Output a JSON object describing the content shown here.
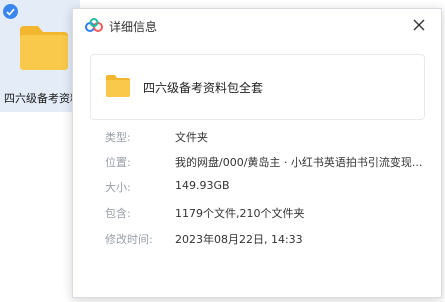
{
  "background": {
    "file_name": "四六级备考资料包全套"
  },
  "dialog": {
    "title": "详细信息",
    "item_name": "四六级备考资料包全套",
    "fields": [
      {
        "label": "类型:",
        "value": "文件夹"
      },
      {
        "label": "位置:",
        "value": "我的网盘/000/黄岛主 · 小红书英语拍书引流变现..."
      },
      {
        "label": "大小:",
        "value": "149.93GB"
      },
      {
        "label": "包含:",
        "value": "1179个文件,210个文件夹"
      },
      {
        "label": "修改时间:",
        "value": "2023年08月22日, 14:33"
      }
    ]
  },
  "colors": {
    "folder_yellow": "#f8c94a",
    "check_blue": "#3a86f0",
    "selection_bg": "#e4ecf8"
  },
  "icons": [
    "check-icon",
    "folder-icon",
    "cloud-logo-icon",
    "close-icon"
  ]
}
